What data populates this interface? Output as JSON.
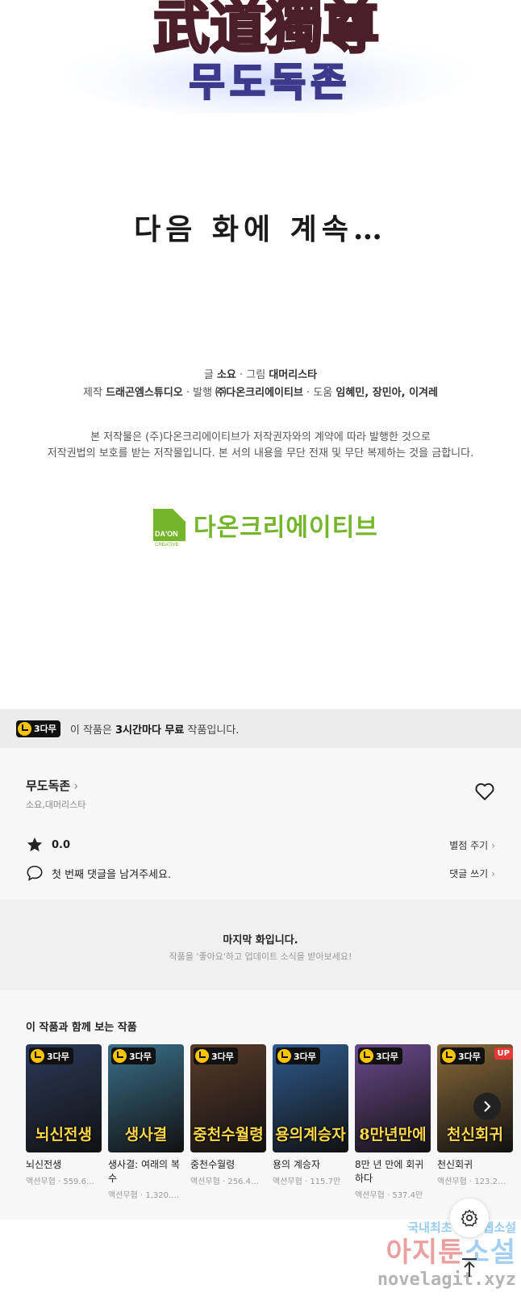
{
  "comic": {
    "title_hanja": "武道獨尊",
    "title_hangul": "무도독존",
    "continue": "다음 화에 계속…",
    "credits": {
      "writer_label": "글",
      "writer": "소요",
      "artist_label": "그림",
      "artist": "대머리스타",
      "production_label": "제작",
      "production": "드래곤엠스튜디오",
      "publisher_label": "발행",
      "publisher": "㈜다온크리에이티브",
      "assist_label": "도움",
      "assist": "임혜민, 장민아, 이겨레"
    },
    "copyright_line1": "본 저작물은 (주)다온크리에이티브가 저작권자와의 계약에 따라 발행한 것으로",
    "copyright_line2": "저작권법의 보호를 받는 저작물입니다. 본 서의 내용을 무단 전재 및 무단 복제하는 것을 금합니다.",
    "logo_mark": "DA'ON",
    "logo_sub": "CREATIVE",
    "logo_text": "다온크리에이티브"
  },
  "free_banner": {
    "badge": "3다무",
    "text_prefix": "이 작품은 ",
    "text_bold": "3시간마다 무료",
    "text_suffix": " 작품입니다."
  },
  "work": {
    "title": "무도독존",
    "authors": "소요,대머리스타",
    "rating": "0.0",
    "rate_action": "별점 주기",
    "comment_prompt": "첫 번째 댓글을 남겨주세요.",
    "comment_action": "댓글 쓰기"
  },
  "last_episode": {
    "title": "마지막 화입니다.",
    "subtitle": "작품을 '좋아요'하고 업데이트 소식을 받아보세요!"
  },
  "recommendations": {
    "heading": "이 작품과 함께 보는 작품",
    "items": [
      {
        "name": "뇌신전생",
        "meta": "액션무협 · 559.6…",
        "badge": "3다무",
        "art": "뇌신전생",
        "color": "#2b3a5a",
        "up": ""
      },
      {
        "name": "생사결: 여래의 복수",
        "meta": "액션무협 · 1,320.…",
        "badge": "3다무",
        "art": "생사결",
        "color": "#3a6f8a",
        "up": ""
      },
      {
        "name": "중천수월령",
        "meta": "액션무협 · 256.4…",
        "badge": "3다무",
        "art": "중천수월령",
        "color": "#5a3b2a",
        "up": ""
      },
      {
        "name": "용의 계승자",
        "meta": "액션무협 · 115.7만",
        "badge": "3다무",
        "art": "용의계승자",
        "color": "#2f5b8e",
        "up": ""
      },
      {
        "name": "8만 년 만에 회귀하다",
        "meta": "액션무협 · 537.4만",
        "badge": "3다무",
        "art": "8만년만에",
        "color": "#6b4a8c",
        "up": ""
      },
      {
        "name": "천신회귀",
        "meta": "액션무협 · 123.2…",
        "badge": "3다무",
        "art": "천신회귀",
        "color": "#8a6a3a",
        "up": "UP"
      }
    ]
  },
  "watermark": {
    "line1_a": "국내최초 무료 ",
    "line1_b": "웹소설",
    "line2_a": "아지툰",
    "line2_b": "소설",
    "line3": "novelagit.xyz"
  },
  "colors": {
    "accent_green": "#74b52a",
    "badge_yellow": "#ffc400",
    "up_red": "#e53935"
  }
}
